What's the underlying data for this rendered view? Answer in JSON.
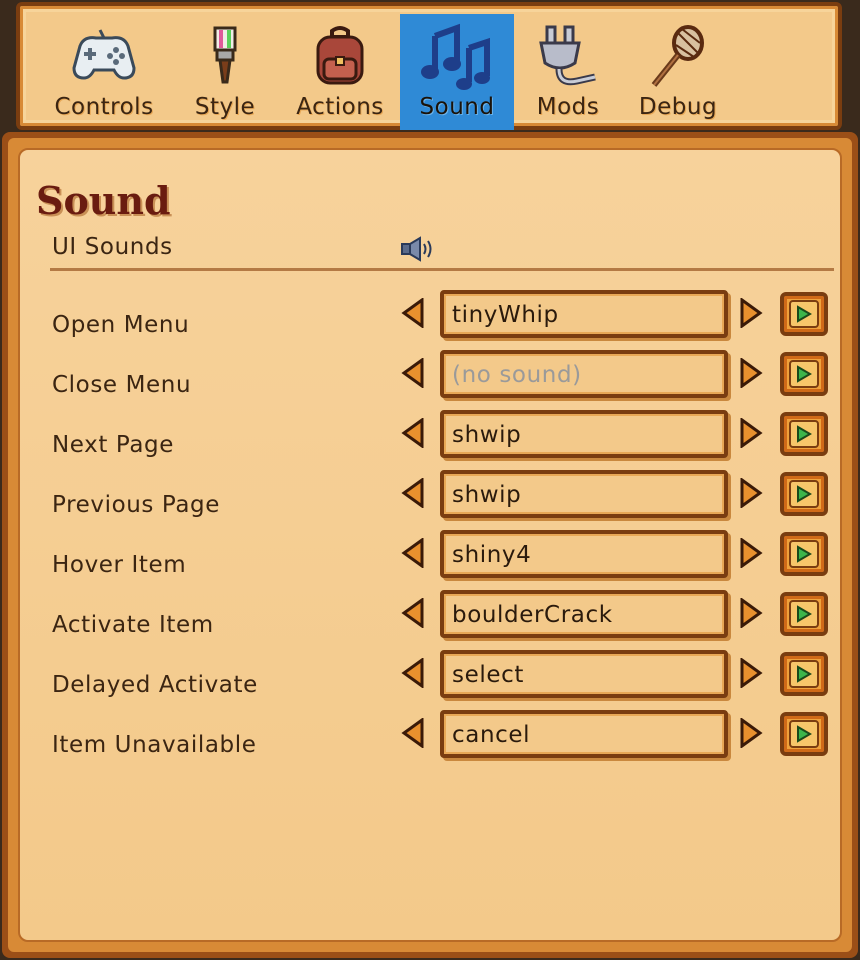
{
  "tabs": [
    {
      "label": "Controls",
      "icon": "gamepad-icon",
      "active": false
    },
    {
      "label": "Style",
      "icon": "paintbrush-icon",
      "active": false
    },
    {
      "label": "Actions",
      "icon": "backpack-icon",
      "active": false
    },
    {
      "label": "Sound",
      "icon": "music-notes-icon",
      "active": true
    },
    {
      "label": "Mods",
      "icon": "plug-icon",
      "active": false
    },
    {
      "label": "Debug",
      "icon": "bug-net-icon",
      "active": false
    }
  ],
  "page": {
    "title": "Sound",
    "ui_sounds_label": "UI Sounds",
    "ui_sounds_icon": "speaker-icon"
  },
  "rows": [
    {
      "label": "Open Menu",
      "value": "tinyWhip"
    },
    {
      "label": "Close Menu",
      "value": "(no sound)"
    },
    {
      "label": "Next Page",
      "value": "shwip"
    },
    {
      "label": "Previous Page",
      "value": "shwip"
    },
    {
      "label": "Hover Item",
      "value": "shiny4"
    },
    {
      "label": "Activate Item",
      "value": "boulderCrack"
    },
    {
      "label": "Delayed Activate",
      "value": "select"
    },
    {
      "label": "Item Unavailable",
      "value": "cancel"
    }
  ],
  "colors": {
    "active_tab": "#2f8ad6",
    "panel_bg": "#f3c98a",
    "frame": "#7a3d10",
    "title": "#6a1c10",
    "play_green": "#3bb54a"
  }
}
